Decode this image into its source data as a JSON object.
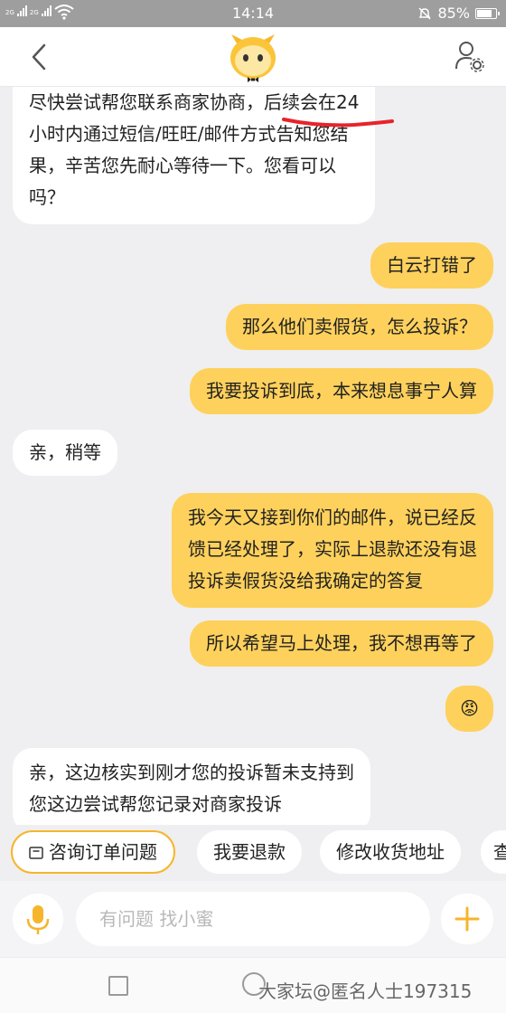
{
  "status_bar": {
    "sig1": "2G",
    "sig2": "2G",
    "time": "14:14",
    "battery": "85%",
    "battery_level": 0.85
  },
  "chat": {
    "messages": [
      {
        "side": "in",
        "lines": [
          "尽快尝试帮您联系商家协商，后续会在24",
          "小时内通过短信/旺旺/邮件方式告知您结",
          "果，辛苦您先耐心等待一下。您看可以",
          "吗？"
        ]
      },
      {
        "side": "out",
        "lines": [
          "白云打错了"
        ]
      },
      {
        "side": "out",
        "lines": [
          "那么他们卖假货，怎么投诉？"
        ]
      },
      {
        "side": "out",
        "lines": [
          "我要投诉到底，本来想息事宁人算"
        ]
      },
      {
        "side": "in",
        "lines": [
          "亲，稍等"
        ]
      },
      {
        "side": "out",
        "lines": [
          "我今天又接到你们的邮件，说已经反",
          "馈已经处理了，实际上退款还没有退",
          "投诉卖假货没给我确定的答复"
        ]
      },
      {
        "side": "out",
        "lines": [
          "所以希望马上处理，我不想再等了"
        ]
      },
      {
        "side": "out",
        "lines": [
          "😡"
        ]
      },
      {
        "side": "in",
        "lines": [
          "亲，这边核实到刚才您的投诉暂未支持到",
          "您这边尝试帮您记录对商家投诉"
        ]
      }
    ]
  },
  "quick_replies": [
    "咨询订单问题",
    "我要退款",
    "修改收货地址",
    "查"
  ],
  "input": {
    "placeholder": "有问题 找小蜜"
  },
  "watermark": "大家坛@匿名人士197315",
  "colors": {
    "accent": "#fed15c",
    "chip_border": "#f6b52b",
    "annotation": "#e8232a",
    "mic": "#f6b52b",
    "plus": "#f6b52b"
  },
  "icons": [
    "back-arrow-icon",
    "assistant-logo-icon",
    "profile-settings-icon",
    "mic-icon",
    "plus-icon",
    "order-icon",
    "home-square-icon",
    "home-circle-icon",
    "wifi-icon",
    "mute-icon",
    "battery-icon"
  ]
}
